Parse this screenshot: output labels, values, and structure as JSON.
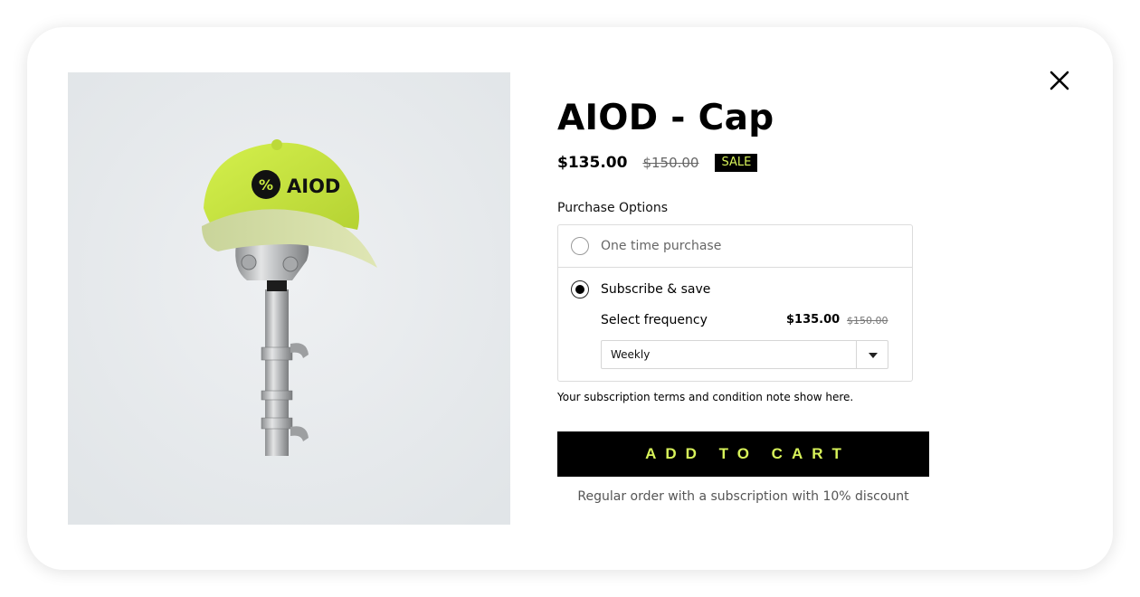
{
  "product": {
    "title": "AIOD - Cap",
    "price": "$135.00",
    "original_price": "$150.00",
    "badge": "SALE",
    "image_logo_text": "AIOD",
    "image_icon": "percent-icon"
  },
  "purchase": {
    "label": "Purchase Options",
    "options": [
      {
        "label": "One time purchase",
        "selected": false
      },
      {
        "label": "Subscribe & save",
        "selected": true
      }
    ],
    "frequency_label": "Select frequency",
    "frequency_price": "$135.00",
    "frequency_original_price": "$150.00",
    "frequency_value": "Weekly",
    "terms": "Your subscription terms and condition note show here."
  },
  "cta": {
    "add_to_cart_label": "ADD TO CART",
    "note": "Regular order with a subscription with 10% discount"
  },
  "icons": {
    "close": "close-icon",
    "caret": "chevron-down-icon"
  },
  "colors": {
    "accent": "#d8f35a",
    "button_bg": "#000000",
    "cap": "#c9ea3f"
  }
}
